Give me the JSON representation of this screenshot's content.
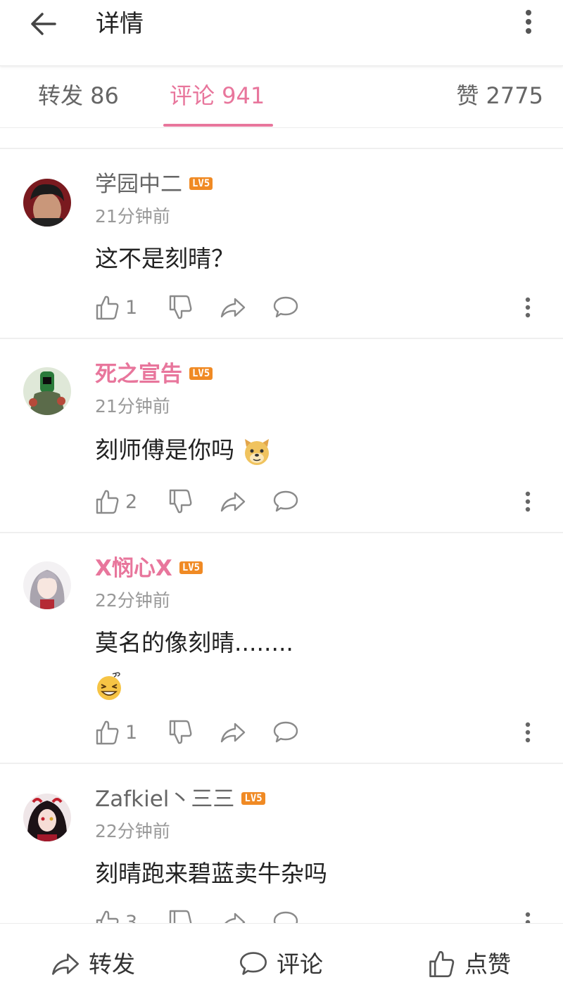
{
  "header": {
    "title": "详情",
    "back_icon": "arrow-left-icon",
    "more_icon": "more-vertical-icon"
  },
  "tabs": {
    "repost": "转发 86",
    "comment": "评论 941",
    "like": "赞 2775",
    "active_color": "#e8769c"
  },
  "comments": [
    {
      "username": "学园中二",
      "level": "LV5",
      "vip": false,
      "time": "21分钟前",
      "text": "这不是刻晴？",
      "emoji": "",
      "likes": "1"
    },
    {
      "username": "死之宣告",
      "level": "LV5",
      "vip": true,
      "time": "21分钟前",
      "text": "刻师傅是你吗",
      "emoji": "doge-emoji",
      "likes": "2"
    },
    {
      "username": "X悯心X",
      "level": "LV5",
      "vip": true,
      "time": "22分钟前",
      "text": "莫名的像刻晴........",
      "emoji": "dizzy-grin-emoji",
      "likes": "1"
    },
    {
      "username": "Zafkiel丶三三",
      "level": "LV5",
      "vip": false,
      "time": "22分钟前",
      "text": "刻晴跑来碧蓝卖牛杂吗",
      "emoji": "",
      "likes": "3"
    }
  ],
  "bottom_bar": {
    "repost": "转发",
    "comment": "评论",
    "like": "点赞"
  },
  "colors": {
    "accent": "#e8769c",
    "level_badge": "#f08a24",
    "secondary_text": "#999999"
  }
}
